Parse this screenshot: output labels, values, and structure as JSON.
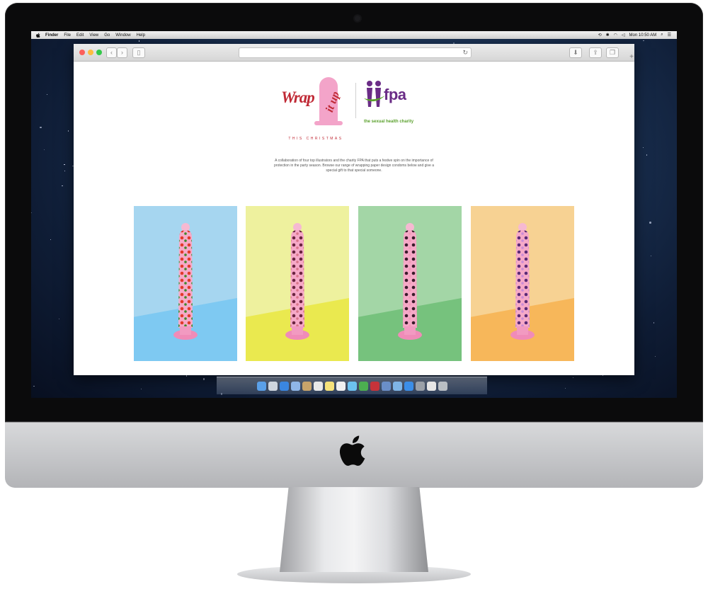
{
  "menubar": {
    "app": "Finder",
    "items": [
      "File",
      "Edit",
      "View",
      "Go",
      "Window",
      "Help"
    ],
    "clock": "Mon 10:50 AM"
  },
  "browser": {
    "address": "",
    "toolbar_icons": [
      "back-icon",
      "forward-icon",
      "sidebar-icon",
      "reload-icon",
      "download-icon",
      "share-icon",
      "tabs-icon",
      "new-tab-icon"
    ]
  },
  "page": {
    "logo_left": {
      "wrap": "Wrap",
      "it_up": "it up",
      "tagline": "THIS CHRISTMAS"
    },
    "logo_right": {
      "name": "fpa",
      "tagline": "the sexual health charity"
    },
    "intro": "A collaboration of four top illustrators and the charity FPA that puts a festive spin on the importance of protection in the party season. Browse our range of wrapping paper design condoms below and give a special gift to that special someone.",
    "products": [
      {
        "back": "#a6d6f0",
        "floor": "#7ec9f2",
        "pattern": "#e23a2b",
        "accent": "#3f8a2a"
      },
      {
        "back": "#eef19e",
        "floor": "#eae94f",
        "pattern": "#6b2440",
        "accent": "#d9768a"
      },
      {
        "back": "#a3d6a6",
        "floor": "#76c27d",
        "pattern": "#3a1a2a",
        "accent": "#f19cb7"
      },
      {
        "back": "#f7d293",
        "floor": "#f7b75a",
        "pattern": "#5a2a77",
        "accent": "#c98bd6"
      }
    ]
  },
  "dock": {
    "items": [
      "finder",
      "launchpad",
      "safari",
      "mail",
      "contacts",
      "calendar",
      "notes",
      "reminders",
      "messages",
      "facetime",
      "photo-booth",
      "iphoto",
      "itunes",
      "app-store",
      "system-preferences",
      "documents",
      "trash"
    ]
  },
  "colors": {
    "wrap_red": "#c02a36",
    "condom_pink": "#f3a4c9",
    "fpa_purple": "#6a2c86",
    "fpa_green": "#5aa02c"
  }
}
